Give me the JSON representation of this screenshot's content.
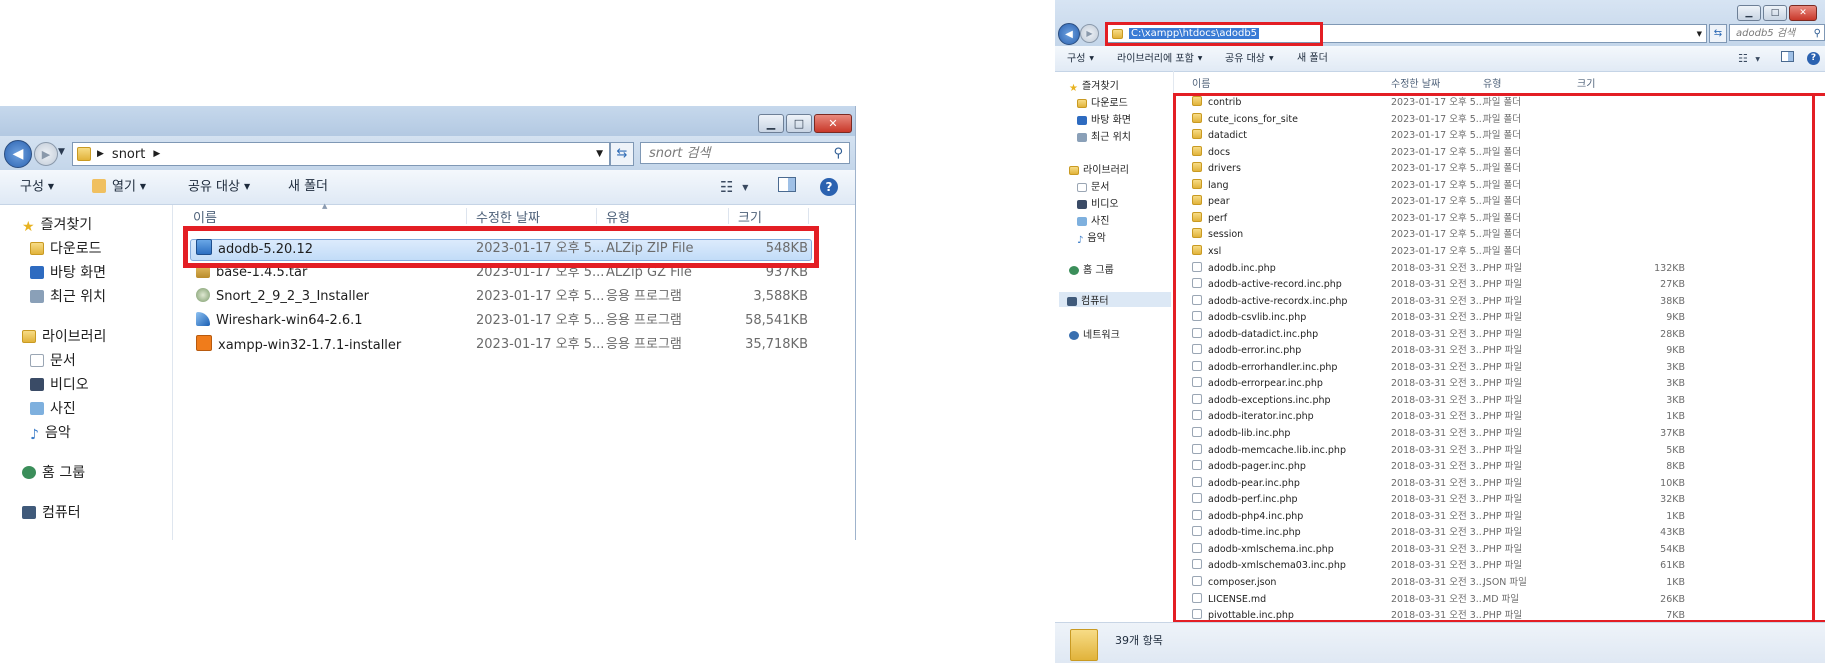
{
  "left_window": {
    "path": [
      "snort"
    ],
    "search_placeholder": "snort 검색",
    "toolbar": {
      "organize": "구성",
      "open": "열기",
      "share": "공유 대상",
      "new_folder": "새 폴더"
    },
    "sidebar": {
      "favorites": "즐겨찾기",
      "favorites_items": [
        "다운로드",
        "바탕 화면",
        "최근 위치"
      ],
      "libraries": "라이브러리",
      "libraries_items": [
        "문서",
        "비디오",
        "사진",
        "음악"
      ],
      "homegroup": "홈 그룹",
      "computer": "컴퓨터"
    },
    "columns": {
      "name": "이름",
      "modified": "수정한 날짜",
      "type": "유형",
      "size": "크기"
    },
    "files": [
      {
        "name": "adodb-5.20.12",
        "modified": "2023-01-17 오후 5...",
        "type": "ALZip ZIP File",
        "size": "548KB",
        "icon": "zip-icon",
        "selected": true
      },
      {
        "name": "base-1.4.5.tar",
        "modified": "2023-01-17 오후 5...",
        "type": "ALZip GZ File",
        "size": "937KB",
        "icon": "archive-icon",
        "selected": false
      },
      {
        "name": "Snort_2_9_2_3_Installer",
        "modified": "2023-01-17 오후 5...",
        "type": "응용 프로그램",
        "size": "3,588KB",
        "icon": "installer-icon",
        "selected": false
      },
      {
        "name": "Wireshark-win64-2.6.1",
        "modified": "2023-01-17 오후 5...",
        "type": "응용 프로그램",
        "size": "58,541KB",
        "icon": "wireshark-icon",
        "selected": false
      },
      {
        "name": "xampp-win32-1.7.1-installer",
        "modified": "2023-01-17 오후 5...",
        "type": "응용 프로그램",
        "size": "35,718KB",
        "icon": "xampp-icon",
        "selected": false
      }
    ]
  },
  "right_window": {
    "address": "C:\\xampp\\htdocs\\adodb5",
    "search_placeholder": "adodb5 검색",
    "toolbar": {
      "organize": "구성",
      "include_library": "라이브러리에 포함",
      "share": "공유 대상",
      "new_folder": "새 폴더"
    },
    "sidebar": {
      "favorites": "즐겨찾기",
      "favorites_items": [
        "다운로드",
        "바탕 화면",
        "최근 위치"
      ],
      "libraries": "라이브러리",
      "libraries_items": [
        "문서",
        "비디오",
        "사진",
        "음악"
      ],
      "homegroup": "홈 그룹",
      "computer": "컴퓨터",
      "network": "네트워크"
    },
    "columns": {
      "name": "이름",
      "modified": "수정한 날짜",
      "type": "유형",
      "size": "크기"
    },
    "files": [
      {
        "name": "contrib",
        "modified": "2023-01-17 오후 5...",
        "type": "파일 폴더",
        "size": "",
        "kind": "folder"
      },
      {
        "name": "cute_icons_for_site",
        "modified": "2023-01-17 오후 5...",
        "type": "파일 폴더",
        "size": "",
        "kind": "folder"
      },
      {
        "name": "datadict",
        "modified": "2023-01-17 오후 5...",
        "type": "파일 폴더",
        "size": "",
        "kind": "folder"
      },
      {
        "name": "docs",
        "modified": "2023-01-17 오후 5...",
        "type": "파일 폴더",
        "size": "",
        "kind": "folder"
      },
      {
        "name": "drivers",
        "modified": "2023-01-17 오후 5...",
        "type": "파일 폴더",
        "size": "",
        "kind": "folder"
      },
      {
        "name": "lang",
        "modified": "2023-01-17 오후 5...",
        "type": "파일 폴더",
        "size": "",
        "kind": "folder"
      },
      {
        "name": "pear",
        "modified": "2023-01-17 오후 5...",
        "type": "파일 폴더",
        "size": "",
        "kind": "folder"
      },
      {
        "name": "perf",
        "modified": "2023-01-17 오후 5...",
        "type": "파일 폴더",
        "size": "",
        "kind": "folder"
      },
      {
        "name": "session",
        "modified": "2023-01-17 오후 5...",
        "type": "파일 폴더",
        "size": "",
        "kind": "folder"
      },
      {
        "name": "xsl",
        "modified": "2023-01-17 오후 5...",
        "type": "파일 폴더",
        "size": "",
        "kind": "folder"
      },
      {
        "name": "adodb.inc.php",
        "modified": "2018-03-31 오전 3...",
        "type": "PHP 파일",
        "size": "132KB",
        "kind": "file"
      },
      {
        "name": "adodb-active-record.inc.php",
        "modified": "2018-03-31 오전 3...",
        "type": "PHP 파일",
        "size": "27KB",
        "kind": "file"
      },
      {
        "name": "adodb-active-recordx.inc.php",
        "modified": "2018-03-31 오전 3...",
        "type": "PHP 파일",
        "size": "38KB",
        "kind": "file"
      },
      {
        "name": "adodb-csvlib.inc.php",
        "modified": "2018-03-31 오전 3...",
        "type": "PHP 파일",
        "size": "9KB",
        "kind": "file"
      },
      {
        "name": "adodb-datadict.inc.php",
        "modified": "2018-03-31 오전 3...",
        "type": "PHP 파일",
        "size": "28KB",
        "kind": "file"
      },
      {
        "name": "adodb-error.inc.php",
        "modified": "2018-03-31 오전 3...",
        "type": "PHP 파일",
        "size": "9KB",
        "kind": "file"
      },
      {
        "name": "adodb-errorhandler.inc.php",
        "modified": "2018-03-31 오전 3...",
        "type": "PHP 파일",
        "size": "3KB",
        "kind": "file"
      },
      {
        "name": "adodb-errorpear.inc.php",
        "modified": "2018-03-31 오전 3...",
        "type": "PHP 파일",
        "size": "3KB",
        "kind": "file"
      },
      {
        "name": "adodb-exceptions.inc.php",
        "modified": "2018-03-31 오전 3...",
        "type": "PHP 파일",
        "size": "3KB",
        "kind": "file"
      },
      {
        "name": "adodb-iterator.inc.php",
        "modified": "2018-03-31 오전 3...",
        "type": "PHP 파일",
        "size": "1KB",
        "kind": "file"
      },
      {
        "name": "adodb-lib.inc.php",
        "modified": "2018-03-31 오전 3...",
        "type": "PHP 파일",
        "size": "37KB",
        "kind": "file"
      },
      {
        "name": "adodb-memcache.lib.inc.php",
        "modified": "2018-03-31 오전 3...",
        "type": "PHP 파일",
        "size": "5KB",
        "kind": "file"
      },
      {
        "name": "adodb-pager.inc.php",
        "modified": "2018-03-31 오전 3...",
        "type": "PHP 파일",
        "size": "8KB",
        "kind": "file"
      },
      {
        "name": "adodb-pear.inc.php",
        "modified": "2018-03-31 오전 3...",
        "type": "PHP 파일",
        "size": "10KB",
        "kind": "file"
      },
      {
        "name": "adodb-perf.inc.php",
        "modified": "2018-03-31 오전 3...",
        "type": "PHP 파일",
        "size": "32KB",
        "kind": "file"
      },
      {
        "name": "adodb-php4.inc.php",
        "modified": "2018-03-31 오전 3...",
        "type": "PHP 파일",
        "size": "1KB",
        "kind": "file"
      },
      {
        "name": "adodb-time.inc.php",
        "modified": "2018-03-31 오전 3...",
        "type": "PHP 파일",
        "size": "43KB",
        "kind": "file"
      },
      {
        "name": "adodb-xmlschema.inc.php",
        "modified": "2018-03-31 오전 3...",
        "type": "PHP 파일",
        "size": "54KB",
        "kind": "file"
      },
      {
        "name": "adodb-xmlschema03.inc.php",
        "modified": "2018-03-31 오전 3...",
        "type": "PHP 파일",
        "size": "61KB",
        "kind": "file"
      },
      {
        "name": "composer.json",
        "modified": "2018-03-31 오전 3...",
        "type": "JSON 파일",
        "size": "1KB",
        "kind": "file"
      },
      {
        "name": "LICENSE.md",
        "modified": "2018-03-31 오전 3...",
        "type": "MD 파일",
        "size": "26KB",
        "kind": "file"
      },
      {
        "name": "pivottable.inc.php",
        "modified": "2018-03-31 오전 3...",
        "type": "PHP 파일",
        "size": "7KB",
        "kind": "file"
      }
    ],
    "status": "39개 항목"
  },
  "colors": {
    "highlight": "#e31e24",
    "selection": "#cce4fb",
    "titlebar": "#c6d8ec",
    "address_selected": "#3a7bd5"
  }
}
